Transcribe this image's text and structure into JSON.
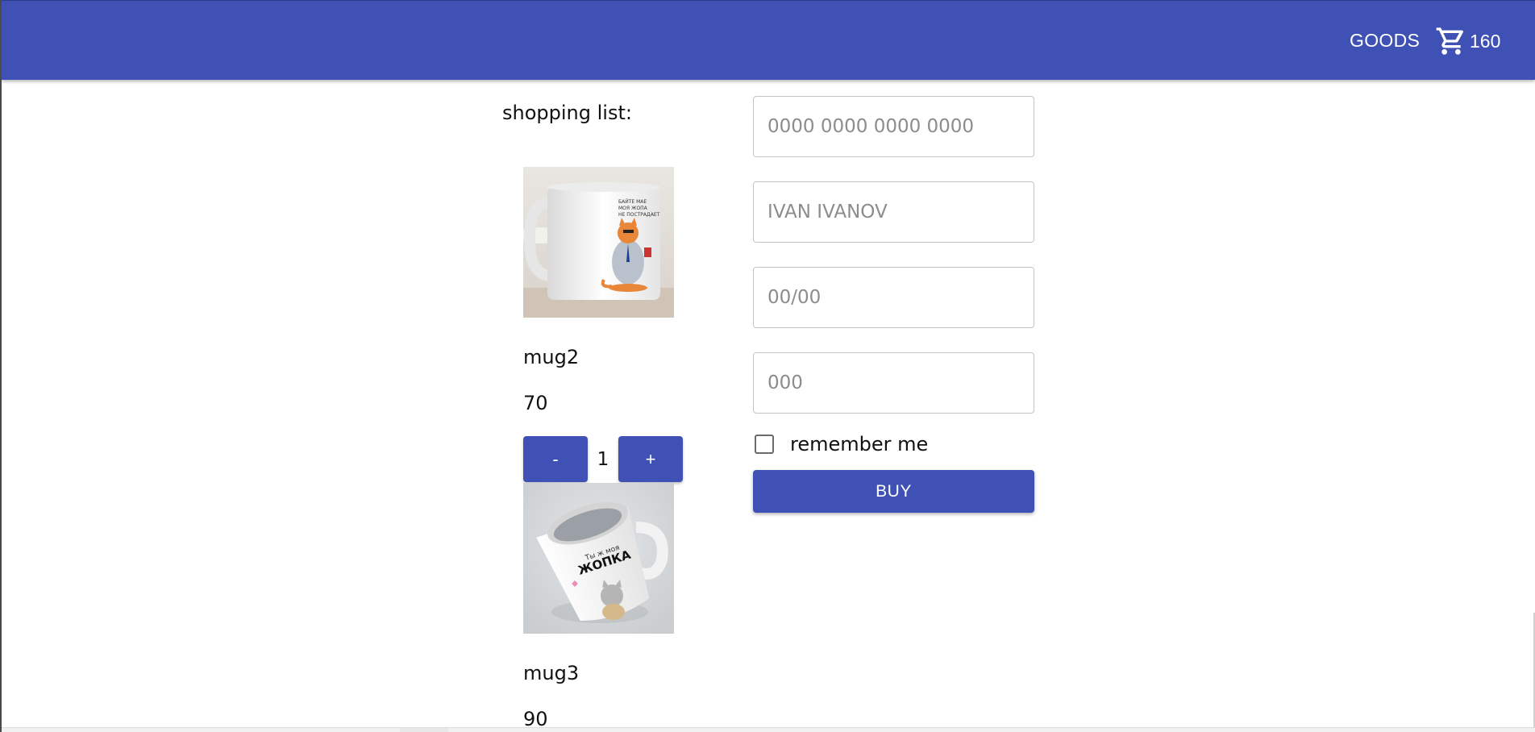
{
  "header": {
    "goods_label": "GOODS",
    "cart_total": "160"
  },
  "shopping_list": {
    "title": "shopping list:",
    "items": [
      {
        "name": "mug2",
        "price": "70",
        "quantity": "1",
        "minus_label": "-",
        "plus_label": "+"
      },
      {
        "name": "mug3",
        "price": "90"
      }
    ]
  },
  "payment": {
    "card_number_placeholder": "0000 0000 0000 0000",
    "card_holder_placeholder": "IVAN IVANOV",
    "expiry_placeholder": "00/00",
    "cvc_placeholder": "000",
    "remember_label": "remember me",
    "buy_label": "BUY"
  },
  "colors": {
    "primary": "#3f51b5",
    "on_primary": "#ffffff"
  },
  "icons": {
    "cart": "cart-icon"
  }
}
